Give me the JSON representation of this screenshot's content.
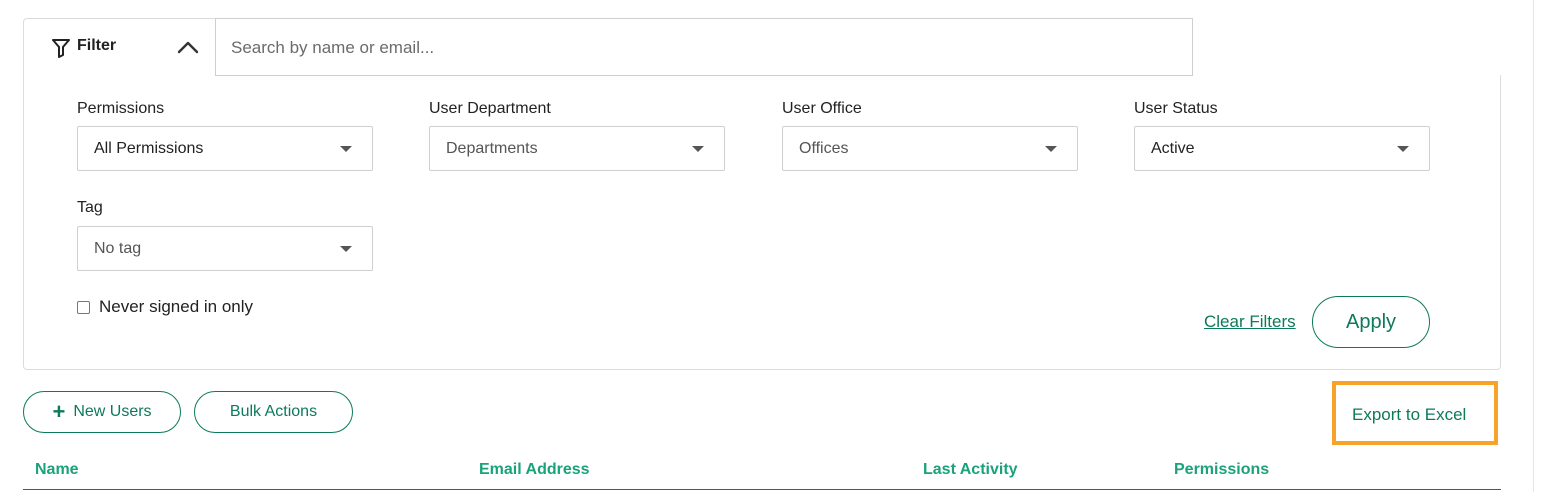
{
  "filter": {
    "tab_label": "Filter",
    "search_placeholder": "Search by name or email..."
  },
  "fields": {
    "permissions": {
      "label": "Permissions",
      "value": "All Permissions"
    },
    "department": {
      "label": "User Department",
      "value": "Departments"
    },
    "office": {
      "label": "User Office",
      "value": "Offices"
    },
    "status": {
      "label": "User Status",
      "value": "Active"
    },
    "tag": {
      "label": "Tag",
      "value": "No tag"
    }
  },
  "checkbox": {
    "label": "Never signed in only",
    "checked": false
  },
  "actions": {
    "clear_filters": "Clear Filters",
    "apply": "Apply",
    "new_users": "New Users",
    "bulk_actions": "Bulk Actions",
    "export": "Export to Excel"
  },
  "table": {
    "columns": [
      "Name",
      "Email Address",
      "Last Activity",
      "Permissions"
    ]
  },
  "colors": {
    "accent": "#0c7a5b",
    "header_text": "#1aa37a",
    "highlight": "#f7a228"
  }
}
